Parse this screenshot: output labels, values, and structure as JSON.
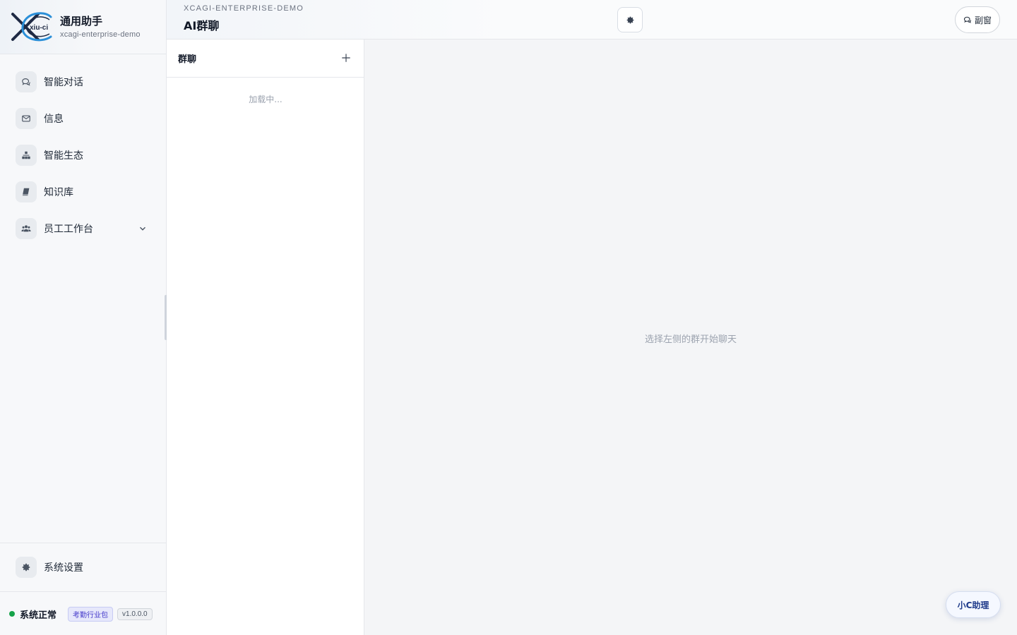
{
  "brand": {
    "title": "通用助手",
    "subtitle": "xcagi-enterprise-demo",
    "logo_text": "xiu-ci"
  },
  "sidebar": {
    "items": [
      {
        "label": "智能对话",
        "icon": "chat-bubbles-icon"
      },
      {
        "label": "信息",
        "icon": "envelope-icon"
      },
      {
        "label": "智能生态",
        "icon": "sitemap-icon"
      },
      {
        "label": "知识库",
        "icon": "book-icon"
      },
      {
        "label": "员工工作台",
        "icon": "users-icon",
        "expandable": true
      }
    ],
    "settings_label": "系统设置"
  },
  "status": {
    "text": "系统正常",
    "pack_badge": "考勤行业包",
    "version": "v1.0.0.0",
    "color": "#16a34a"
  },
  "header": {
    "eyebrow": "XCAGI-ENTERPRISE-DEMO",
    "title": "AI群聊",
    "sub_window_label": "副窗"
  },
  "group_panel": {
    "title": "群聊",
    "loading_text": "加载中..."
  },
  "main": {
    "empty_hint": "选择左侧的群开始聊天"
  },
  "assistant_button": {
    "label": "小C助理"
  }
}
